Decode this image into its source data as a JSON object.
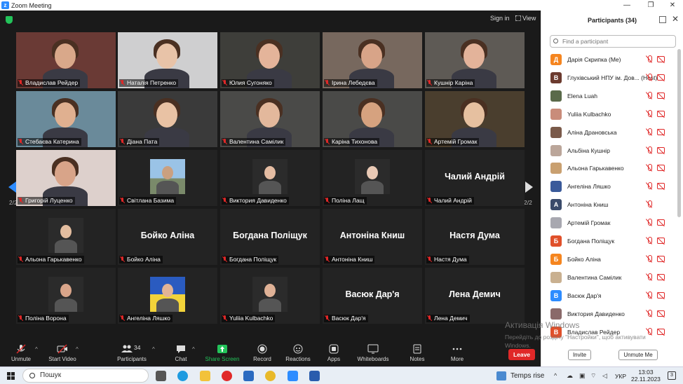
{
  "window": {
    "title": "Zoom Meeting"
  },
  "header": {
    "sign_in": "Sign in",
    "view": "View"
  },
  "pagination": {
    "left": "2/2",
    "right": "2/2"
  },
  "tiles": [
    {
      "name": "Владислав Рейдер",
      "video": true
    },
    {
      "name": "Наталія Петренко",
      "video": true
    },
    {
      "name": "Юлия Сугоняко",
      "video": true
    },
    {
      "name": "Ірина Лебедєва",
      "video": true
    },
    {
      "name": "Кушнір Каріна",
      "video": true
    },
    {
      "name": "Стебаєва Катерина",
      "video": true
    },
    {
      "name": "Діана Пата",
      "video": true
    },
    {
      "name": "Валентина Самілик",
      "video": true
    },
    {
      "name": "Каріна Тихонова",
      "video": true
    },
    {
      "name": "Артемій Громак",
      "video": true
    },
    {
      "name": "Григорій Луценко",
      "video": true
    },
    {
      "name": "Світлана Базима",
      "video": true
    },
    {
      "name": "Виктория Давиденко",
      "video": true
    },
    {
      "name": "Поліна Лащ",
      "video": true
    },
    {
      "name": "Чалий Андрій",
      "video": false
    },
    {
      "name": "Альона Гарькавенко",
      "video": true
    },
    {
      "name": "Бойко Аліна",
      "video": false
    },
    {
      "name": "Богдана Поліщук",
      "video": false
    },
    {
      "name": "Антоніна Книш",
      "video": false
    },
    {
      "name": "Настя Дума",
      "video": false
    },
    {
      "name": "Поліна Ворона",
      "video": true
    },
    {
      "name": "Ангеліна Ляшко",
      "video": true
    },
    {
      "name": "Yuliia Kulbachko",
      "video": true
    },
    {
      "name": "Васюк Дар'я",
      "video": false
    },
    {
      "name": "Лена Демич",
      "video": false
    }
  ],
  "toolbar": {
    "unmute": "Unmute",
    "start_video": "Start Video",
    "participants": "Participants",
    "participants_count": "34",
    "chat": "Chat",
    "share_screen": "Share Screen",
    "record": "Record",
    "reactions": "Reactions",
    "apps": "Apps",
    "whiteboards": "Whiteboards",
    "notes": "Notes",
    "more": "More",
    "leave": "Leave"
  },
  "panel": {
    "title": "Participants (34)",
    "search_placeholder": "Find a participant",
    "invite": "Invite",
    "unmute_me": "Unmute Me",
    "participants": [
      {
        "initial": "Д",
        "color": "#f5851f",
        "name": "Дарія Скрипка (Me)",
        "suffix": ""
      },
      {
        "initial": "В",
        "color": "#6b3a2e",
        "name": "Глухівський НПУ ім. Дов...",
        "suffix": "(Host)"
      },
      {
        "initial": "",
        "color": "#5a6a4a",
        "name": "Elena Luah",
        "suffix": ""
      },
      {
        "initial": "",
        "color": "#c98c7a",
        "name": "Yuliia Kulbachko",
        "suffix": ""
      },
      {
        "initial": "",
        "color": "#7a5a4a",
        "name": "Аліна Драновська",
        "suffix": ""
      },
      {
        "initial": "",
        "color": "#bba69a",
        "name": "Альбіна Кушнір",
        "suffix": ""
      },
      {
        "initial": "",
        "color": "#c9a070",
        "name": "Альона Гарькавенко",
        "suffix": ""
      },
      {
        "initial": "",
        "color": "#3a5a9a",
        "name": "Ангеліна Ляшко",
        "suffix": ""
      },
      {
        "initial": "А",
        "color": "#3a4a6a",
        "name": "Антоніна Книш",
        "suffix": ""
      },
      {
        "initial": "",
        "color": "#a8a8b0",
        "name": "Артемій Громак",
        "suffix": ""
      },
      {
        "initial": "Б",
        "color": "#e0502a",
        "name": "Богдана Поліщук",
        "suffix": ""
      },
      {
        "initial": "Б",
        "color": "#f5851f",
        "name": "Бойко Аліна",
        "suffix": ""
      },
      {
        "initial": "",
        "color": "#c9b090",
        "name": "Валентина Самілик",
        "suffix": ""
      },
      {
        "initial": "В",
        "color": "#2d8cff",
        "name": "Васюк Дар'я",
        "suffix": ""
      },
      {
        "initial": "",
        "color": "#8a6a6a",
        "name": "Виктория Давиденко",
        "suffix": ""
      },
      {
        "initial": "В",
        "color": "#e0502a",
        "name": "Владислав Рейдер",
        "suffix": ""
      }
    ]
  },
  "watermark": {
    "title": "Активація Windows",
    "line1": "Перейдіть до розділу \"Настройки\", щоб активувати",
    "line2": "Windows."
  },
  "taskbar": {
    "search": "Пошук",
    "weather": "Temps rise",
    "lang": "УКР",
    "time": "13:03",
    "date": "22.11.2023",
    "notifications": "3"
  }
}
